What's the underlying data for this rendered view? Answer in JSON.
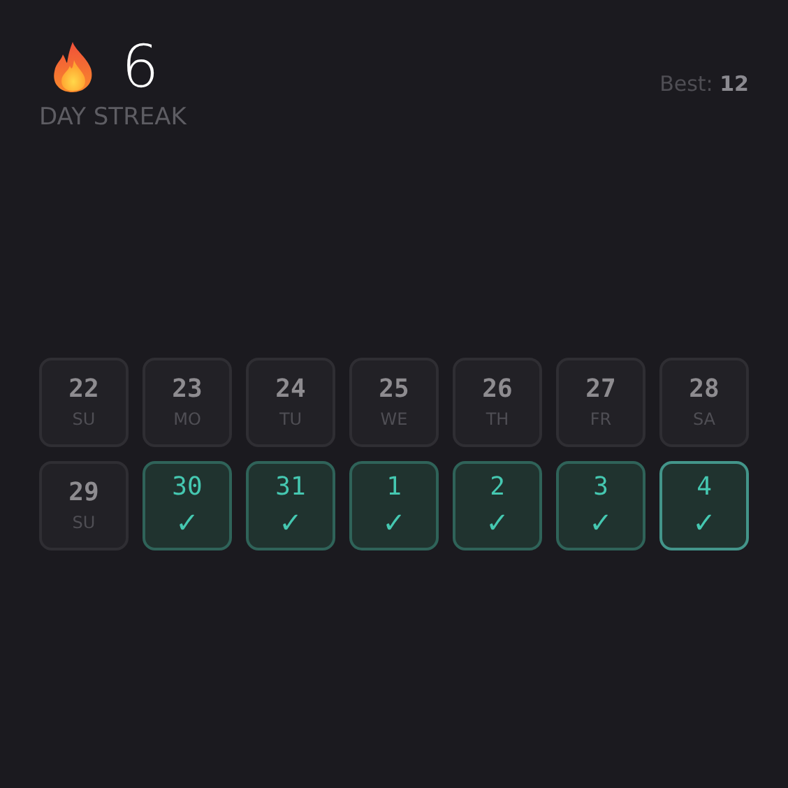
{
  "streak": {
    "count": "6",
    "label": "DAY STREAK"
  },
  "best": {
    "label": "Best:",
    "value": "12"
  },
  "weeks": [
    [
      {
        "day": "22",
        "weekday": "SU",
        "done": false,
        "today": false
      },
      {
        "day": "23",
        "weekday": "MO",
        "done": false,
        "today": false
      },
      {
        "day": "24",
        "weekday": "TU",
        "done": false,
        "today": false
      },
      {
        "day": "25",
        "weekday": "WE",
        "done": false,
        "today": false
      },
      {
        "day": "26",
        "weekday": "TH",
        "done": false,
        "today": false
      },
      {
        "day": "27",
        "weekday": "FR",
        "done": false,
        "today": false
      },
      {
        "day": "28",
        "weekday": "SA",
        "done": false,
        "today": false
      }
    ],
    [
      {
        "day": "29",
        "weekday": "SU",
        "done": false,
        "today": false
      },
      {
        "day": "30",
        "mark": "✓",
        "done": true,
        "today": false
      },
      {
        "day": "31",
        "mark": "✓",
        "done": true,
        "today": false
      },
      {
        "day": "1",
        "mark": "✓",
        "done": true,
        "today": false
      },
      {
        "day": "2",
        "mark": "✓",
        "done": true,
        "today": false
      },
      {
        "day": "3",
        "mark": "✓",
        "done": true,
        "today": false
      },
      {
        "day": "4",
        "mark": "✓",
        "done": true,
        "today": true
      }
    ]
  ]
}
